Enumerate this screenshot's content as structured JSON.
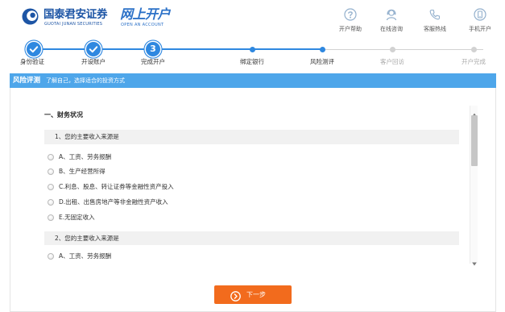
{
  "header": {
    "brand_name": "国泰君安证券",
    "brand_english": "GUOTAI JUNAN SECURITIES",
    "product_name": "网上开户",
    "product_english": "OPEN AN ACCOUNT",
    "links": [
      {
        "label": "开户帮助",
        "icon": "help-icon"
      },
      {
        "label": "在线咨询",
        "icon": "online-consult-icon"
      },
      {
        "label": "客服热线",
        "icon": "hotline-icon"
      },
      {
        "label": "手机开户",
        "icon": "mobile-account-icon"
      }
    ]
  },
  "steps": [
    {
      "label": "身份验证",
      "status": "done"
    },
    {
      "label": "开设账户",
      "status": "done"
    },
    {
      "label": "完成开户",
      "status": "done",
      "number": "3"
    },
    {
      "label": "绑定银行",
      "status": "done"
    },
    {
      "label": "风险测评",
      "status": "current"
    },
    {
      "label": "客户回访",
      "status": "pending"
    },
    {
      "label": "开户完成",
      "status": "pending"
    }
  ],
  "section_bar": {
    "title": "风险评测",
    "subtitle": "了解自己，选择适合的投资方式"
  },
  "survey": {
    "section_title": "一、财务状况",
    "questions": [
      {
        "title": "1、您的主要收入来源是",
        "options": [
          "A、工资、劳务报酬",
          "B、生产经营所得",
          "C.利息、股息、转让证券等金融性资产投入",
          "D.出租、出售房地产等非金融性资产收入",
          "E.无固定收入"
        ]
      },
      {
        "title": "2、您的主要收入来源是",
        "options": [
          "A、工资、劳务报酬"
        ]
      }
    ]
  },
  "next_button": {
    "label": "下一步",
    "icon": "arrow-circle-icon"
  },
  "colors": {
    "accent": "#2f88e0",
    "section_bar": "#4ea6ea",
    "next_button": "#f26b1d",
    "pending": "#d2d2d2",
    "brand": "#1d55a5"
  }
}
